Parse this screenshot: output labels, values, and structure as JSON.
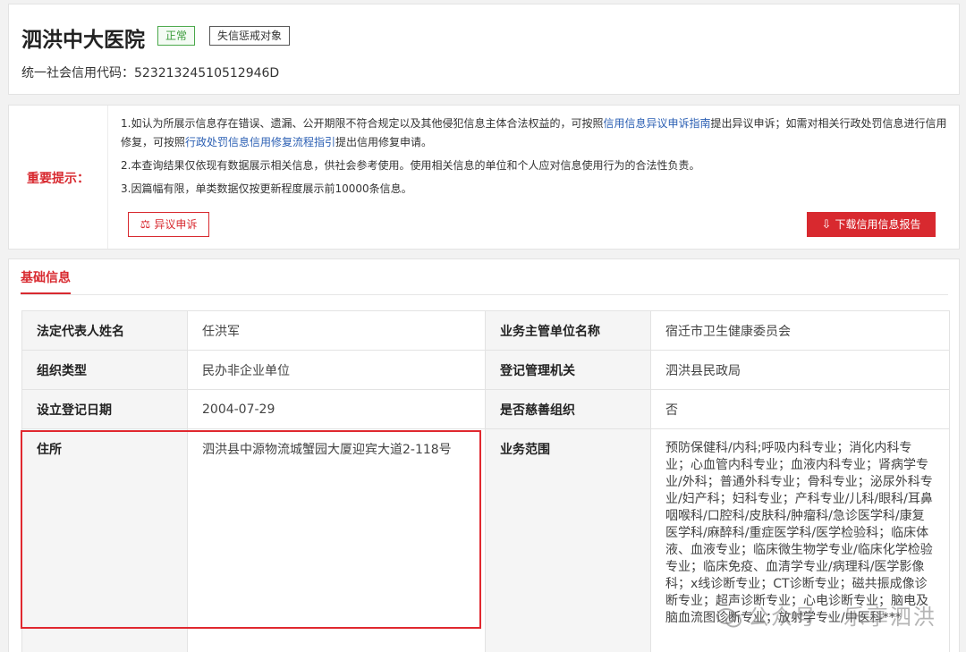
{
  "header": {
    "org_name": "泗洪中大医院",
    "status_tag": "正常",
    "warn_tag": "失信惩戒对象",
    "credit_code_label": "统一社会信用代码：",
    "credit_code": "52321324510512946D"
  },
  "notice": {
    "title": "重要提示：",
    "line1_pre": "1.如认为所展示信息存在错误、遗漏、公开期限不符合规定以及其他侵犯信息主体合法权益的，可按照",
    "line1_link1": "信用信息异议申诉指南",
    "line1_mid": "提出异议申诉；如需对相关行政处罚信息进行信用修复，可按照",
    "line1_link2": "行政处罚信息信用修复流程指引",
    "line1_post": "提出信用修复申请。",
    "line2": "2.本查询结果仅依现有数据展示相关信息，供社会参考使用。使用相关信息的单位和个人应对信息使用行为的合法性负责。",
    "line3": "3.因篇幅有限，单类数据仅按更新程度展示前10000条信息。",
    "appeal_button": "异议申诉",
    "download_button": "下载信用信息报告"
  },
  "basic": {
    "tab": "基础信息",
    "rows": [
      {
        "label1": "法定代表人姓名",
        "value1": "任洪军",
        "label2": "业务主管单位名称",
        "value2": "宿迁市卫生健康委员会"
      },
      {
        "label1": "组织类型",
        "value1": "民办非企业单位",
        "label2": "登记管理机关",
        "value2": "泗洪县民政局"
      },
      {
        "label1": "设立登记日期",
        "value1": "2004-07-29",
        "label2": "是否慈善组织",
        "value2": "否"
      },
      {
        "label1": "住所",
        "value1": "泗洪县中源物流城蟹园大厦迎宾大道2-118号",
        "label2": "业务范围",
        "value2": "预防保健科/内科;呼吸内科专业；消化内科专业；心血管内科专业；血液内科专业；肾病学专业/外科；普通外科专业；骨科专业；泌尿外科专业/妇产科；妇科专业；产科专业/儿科/眼科/耳鼻咽喉科/口腔科/皮肤科/肿瘤科/急诊医学科/康复医学科/麻醉科/重症医学科/医学检验科；临床体液、血液专业；临床微生物学专业/临床化学检验专业；临床免疫、血清学专业/病理科/医学影像科；x线诊断专业；CT诊断专业；磁共振成像诊断专业；超声诊断专业；心电诊断专业；脑电及脑血流图诊断专业；放射学专业/中医科***"
      }
    ]
  },
  "watermark": "公众号 · 乐享泗洪",
  "colors": {
    "accent": "#d8292f",
    "link": "#2b5fb3",
    "ok": "#3a9b3a"
  }
}
